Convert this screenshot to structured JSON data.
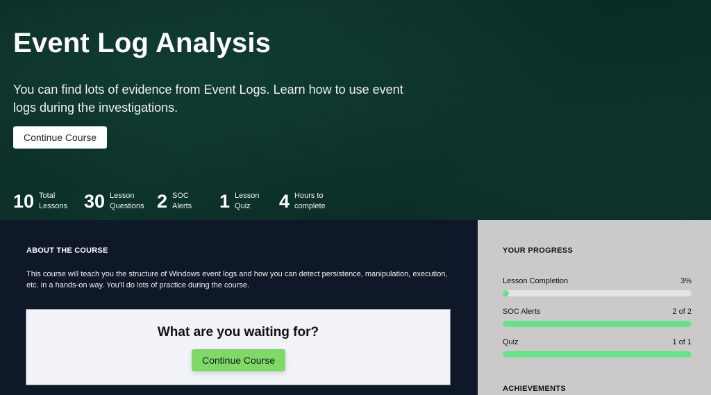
{
  "hero": {
    "title": "Event Log Analysis",
    "description": "You can find lots of evidence from Event Logs. Learn how to use event logs during the investigations.",
    "continue_label": "Continue Course",
    "stats": [
      {
        "value": "10",
        "label_line1": "Total",
        "label_line2": "Lessons"
      },
      {
        "value": "30",
        "label_line1": "Lesson",
        "label_line2": "Questions"
      },
      {
        "value": "2",
        "label_line1": "SOC",
        "label_line2": "Alerts"
      },
      {
        "value": "1",
        "label_line1": "Lesson",
        "label_line2": "Quiz"
      },
      {
        "value": "4",
        "label_line1": "Hours to",
        "label_line2": "complete"
      }
    ]
  },
  "about": {
    "heading": "ABOUT THE COURSE",
    "text": "This course will teach you the structure of Windows event logs and how you can detect persistence, manipulation, execution, etc. in a hands-on way. You'll do lots of practice during the course."
  },
  "cta": {
    "title": "What are you waiting for?",
    "button_label": "Continue Course"
  },
  "progress": {
    "heading": "YOUR PROGRESS",
    "items": [
      {
        "label": "Lesson Completion",
        "value_text": "3%",
        "fraction": 0.03
      },
      {
        "label": "SOC Alerts",
        "value_text": "2 of 2",
        "fraction": 1.0
      },
      {
        "label": "Quiz",
        "value_text": "1 of 1",
        "fraction": 1.0
      }
    ],
    "bar_color": "#65e28a"
  },
  "achievements": {
    "heading": "ACHIEVEMENTS"
  },
  "colors": {
    "hero_bg": "#0c2e27",
    "main_bg": "#0f1828",
    "sidebar_bg": "#cbc9ca",
    "cta_button": "#7fd868"
  }
}
